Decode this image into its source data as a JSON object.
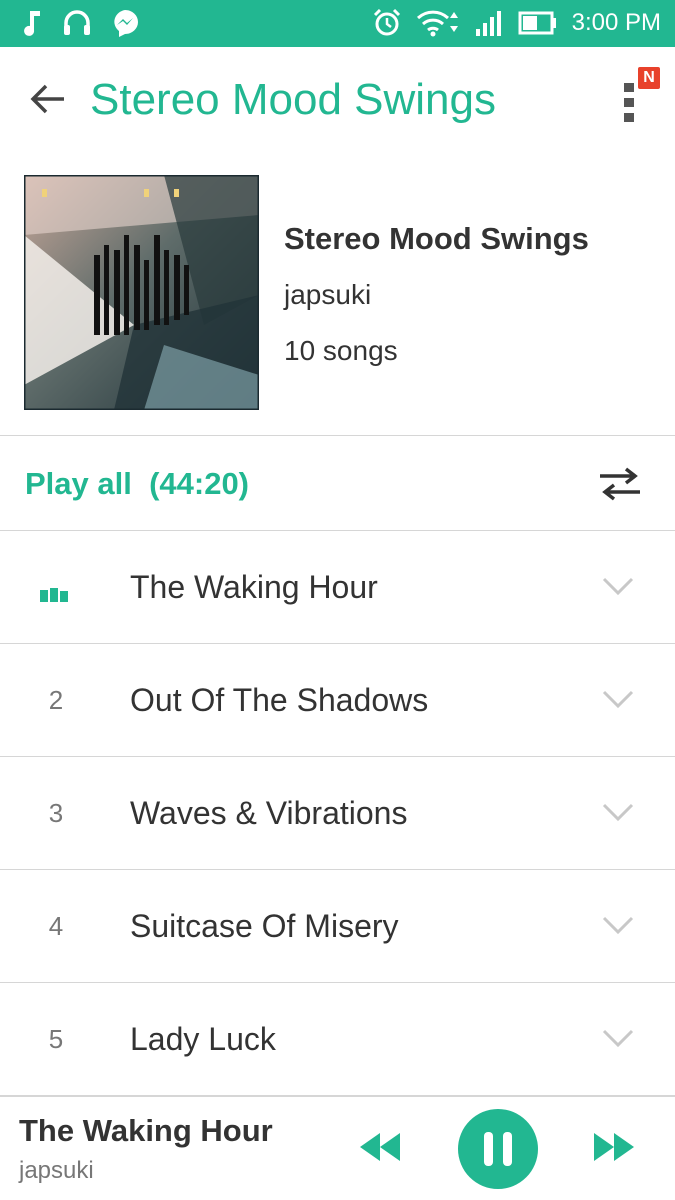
{
  "status_bar": {
    "time": "3:00 PM",
    "left_icons": [
      "music-note-icon",
      "headphones-icon",
      "messenger-icon"
    ],
    "right_icons": [
      "alarm-icon",
      "wifi-icon",
      "signal-icon",
      "battery-icon"
    ],
    "color": "#22b791"
  },
  "header": {
    "title": "Stereo Mood Swings",
    "badge": "N",
    "accent_color": "#22b791"
  },
  "album": {
    "title": "Stereo Mood Swings",
    "artist": "japsuki",
    "song_count": "10 songs"
  },
  "play_all": {
    "label": "Play all  (44:20)"
  },
  "tracks": [
    {
      "number": "",
      "title": "The Waking Hour",
      "playing": true
    },
    {
      "number": "2",
      "title": "Out Of The Shadows",
      "playing": false
    },
    {
      "number": "3",
      "title": "Waves & Vibrations",
      "playing": false
    },
    {
      "number": "4",
      "title": "Suitcase Of Misery",
      "playing": false
    },
    {
      "number": "5",
      "title": "Lady Luck",
      "playing": false
    }
  ],
  "now_playing": {
    "title": "The Waking Hour",
    "artist": "japsuki",
    "state": "playing"
  }
}
